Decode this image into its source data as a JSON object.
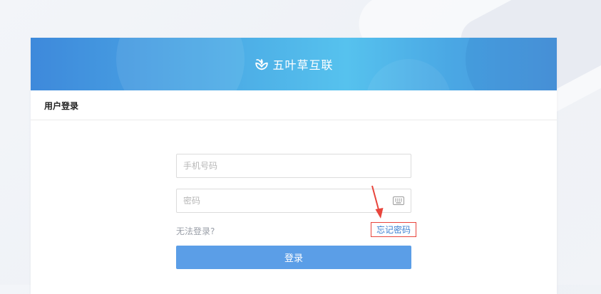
{
  "brand": {
    "name": "五叶草互联",
    "logo_icon": "clover-leaf-icon"
  },
  "login_panel": {
    "title": "用户登录",
    "phone": {
      "placeholder": "手机号码",
      "value": ""
    },
    "password": {
      "placeholder": "密码",
      "value": "",
      "trailing_icon": "keyboard-icon"
    },
    "cant_login_label": "无法登录?",
    "forgot_password_label": "忘记密码",
    "submit_label": "登录"
  },
  "annotation": {
    "arrow_icon": "red-arrow-icon",
    "highlight_color": "#e8453c"
  },
  "colors": {
    "banner_start": "#3e89db",
    "banner_end": "#56c2ee",
    "button": "#5b9ee7",
    "link": "#3b7fd1"
  }
}
